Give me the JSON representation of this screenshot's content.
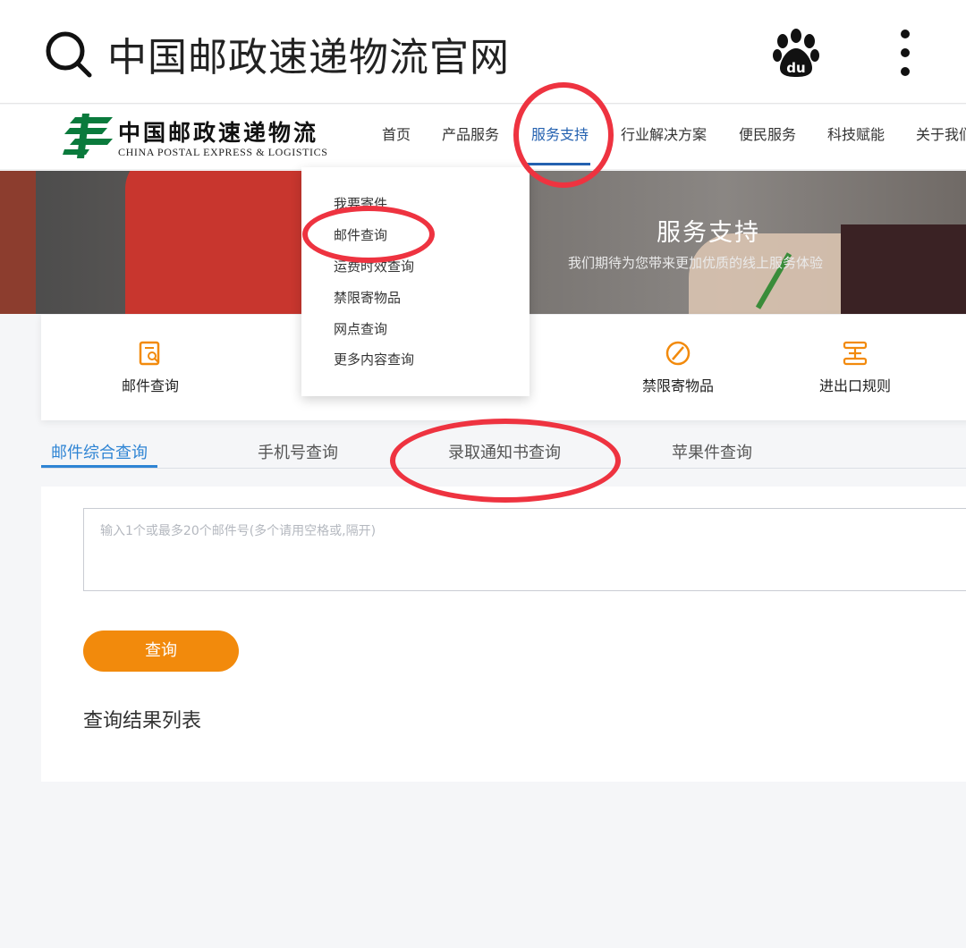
{
  "search": {
    "query": "中国邮政速递物流官网"
  },
  "icons": {
    "search": "search-icon",
    "baidu": "baidu-paw-icon",
    "more": "more-vertical-icon"
  },
  "site": {
    "logo_cn": "中国邮政速递物流",
    "logo_en": "CHINA POSTAL EXPRESS & LOGISTICS",
    "nav": [
      "首页",
      "产品服务",
      "服务支持",
      "行业解决方案",
      "便民服务",
      "科技赋能",
      "关于我们"
    ],
    "nav_active": "服务支持",
    "brand_color": "#0a7a3c",
    "accent_color": "#2461b0"
  },
  "dropdown": {
    "items": [
      "我要寄件",
      "邮件查询",
      "运费时效查询",
      "禁限寄物品",
      "网点查询",
      "更多内容查询"
    ]
  },
  "banner": {
    "title": "服务支持",
    "subtitle": "我们期待为您带来更加优质的线上服务体验"
  },
  "quick_links": {
    "items": [
      {
        "label": "邮件查询",
        "icon": "mail-search-icon"
      },
      {
        "label": "禁限寄物品",
        "icon": "prohibited-icon"
      },
      {
        "label": "进出口规则",
        "icon": "import-export-icon"
      }
    ]
  },
  "tabs": {
    "items": [
      "邮件综合查询",
      "手机号查询",
      "录取通知书查询",
      "苹果件查询"
    ],
    "active": "邮件综合查询",
    "active_color": "#2e84d4"
  },
  "query": {
    "placeholder": "输入1个或最多20个邮件号(多个请用空格或,隔开)",
    "button": "查询",
    "button_color": "#f28a0c",
    "result_title": "查询结果列表"
  },
  "annotation_color": "#ee3340"
}
